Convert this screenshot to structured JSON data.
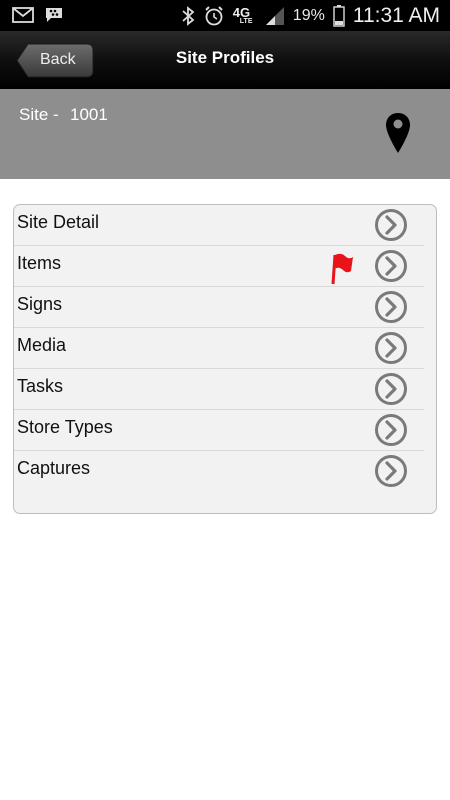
{
  "status_bar": {
    "battery_percent": "19%",
    "time": "11:31 AM",
    "network": "4G",
    "network_sub": "LTE",
    "icons": [
      "mail-icon",
      "bbm-chat-icon",
      "bluetooth-icon",
      "alarm-icon",
      "signal-icon",
      "battery-icon"
    ]
  },
  "titlebar": {
    "back_label": "Back",
    "title": "Site Profiles"
  },
  "site": {
    "label": "Site -",
    "value": "1001",
    "icon": "map-pin-icon"
  },
  "menu": {
    "items": [
      {
        "label": "Site Detail",
        "flag": false
      },
      {
        "label": "Items",
        "flag": true
      },
      {
        "label": "Signs",
        "flag": false
      },
      {
        "label": "Media",
        "flag": false
      },
      {
        "label": "Tasks",
        "flag": false
      },
      {
        "label": "Store Types",
        "flag": false
      },
      {
        "label": "Captures",
        "flag": false
      }
    ]
  },
  "colors": {
    "header_gray": "#8e8e8e",
    "flag_red": "#e8141a",
    "chevron_gray": "#7a7a7a"
  }
}
